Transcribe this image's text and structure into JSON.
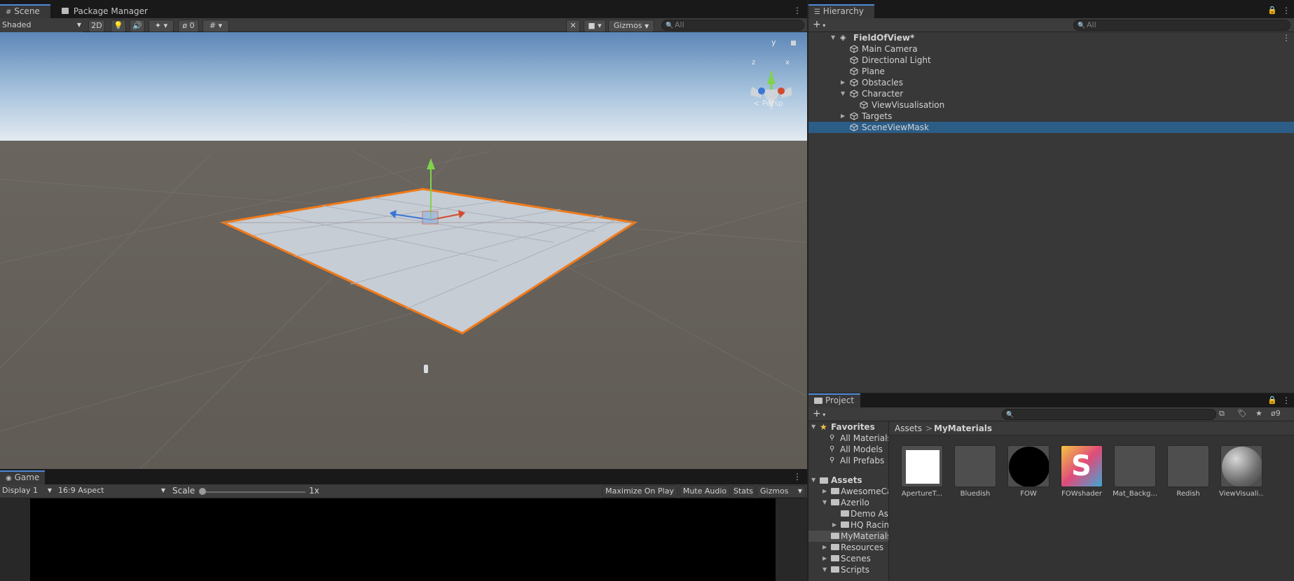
{
  "scene_tabs": {
    "scene": "Scene",
    "package_manager": "Package Manager"
  },
  "scene_toolbar": {
    "shading_mode": "Shaded",
    "mode_2d": "2D",
    "hidden_count": "0",
    "gizmos": "Gizmos",
    "search_placeholder": "All"
  },
  "scene_view": {
    "orientation_gizmo": {
      "y": "y",
      "x": "x",
      "z": "z"
    },
    "projection_label": "< Persp"
  },
  "game": {
    "tab": "Game",
    "display": "Display 1",
    "aspect": "16:9 Aspect",
    "scale_label": "Scale",
    "scale_value": "1x",
    "scale_level": 0,
    "maximize": "Maximize On Play",
    "mute": "Mute Audio",
    "stats": "Stats",
    "gizmos": "Gizmos"
  },
  "hierarchy": {
    "tab": "Hierarchy",
    "search_placeholder": "All",
    "scene_name": "FieldOfView*",
    "items": [
      {
        "label": "Main Camera",
        "depth": 1,
        "arrow": "",
        "selected": false
      },
      {
        "label": "Directional Light",
        "depth": 1,
        "arrow": "",
        "selected": false
      },
      {
        "label": "Plane",
        "depth": 1,
        "arrow": "",
        "selected": false
      },
      {
        "label": "Obstacles",
        "depth": 1,
        "arrow": "right",
        "selected": false
      },
      {
        "label": "Character",
        "depth": 1,
        "arrow": "down",
        "selected": false
      },
      {
        "label": "ViewVisualisation",
        "depth": 2,
        "arrow": "",
        "selected": false
      },
      {
        "label": "Targets",
        "depth": 1,
        "arrow": "right",
        "selected": false
      },
      {
        "label": "SceneViewMask",
        "depth": 1,
        "arrow": "",
        "selected": true
      }
    ]
  },
  "project": {
    "tab": "Project",
    "hidden_count": "9",
    "favorites": {
      "label": "Favorites",
      "items": [
        "All Materials",
        "All Models",
        "All Prefabs"
      ]
    },
    "assets": {
      "label": "Assets",
      "folders": [
        {
          "label": "AwesomeCa",
          "depth": 1,
          "arrow": "right",
          "selected": false
        },
        {
          "label": "Azerilo",
          "depth": 1,
          "arrow": "down",
          "selected": false
        },
        {
          "label": "Demo Ass",
          "depth": 2,
          "arrow": "",
          "selected": false
        },
        {
          "label": "HQ Racin",
          "depth": 2,
          "arrow": "right",
          "selected": false
        },
        {
          "label": "MyMaterials",
          "depth": 1,
          "arrow": "",
          "selected": true
        },
        {
          "label": "Resources",
          "depth": 1,
          "arrow": "right",
          "selected": false
        },
        {
          "label": "Scenes",
          "depth": 1,
          "arrow": "right",
          "selected": false
        },
        {
          "label": "Scripts",
          "depth": 1,
          "arrow": "down",
          "selected": false
        }
      ]
    },
    "breadcrumb": {
      "root": "Assets",
      "separator": ">",
      "current": "MyMaterials"
    },
    "grid_assets": [
      {
        "label": "ApertureT...",
        "kind": "white"
      },
      {
        "label": "Bluedish",
        "kind": "gray"
      },
      {
        "label": "FOW",
        "kind": "black-sphere"
      },
      {
        "label": "FOWshader",
        "kind": "shader"
      },
      {
        "label": "Mat_Backg...",
        "kind": "gray"
      },
      {
        "label": "Redish",
        "kind": "gray"
      },
      {
        "label": "ViewVisuali...",
        "kind": "sphere"
      }
    ],
    "shader_glyph": "S"
  },
  "colors": {
    "selection": "#2c5d87",
    "accent_tab": "#4d89d8",
    "outline_orange": "#f07a1a"
  }
}
